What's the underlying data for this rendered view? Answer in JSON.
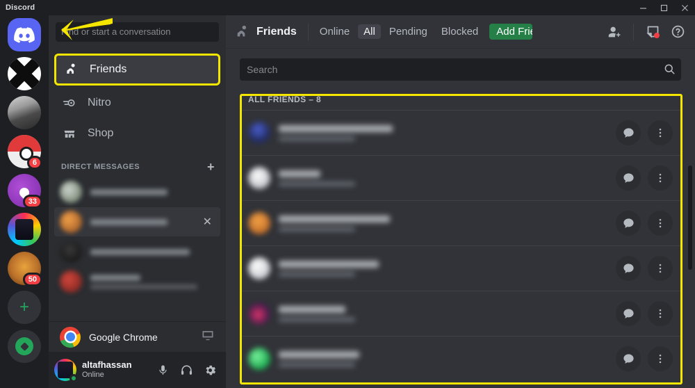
{
  "window": {
    "title": "Discord",
    "controls": {
      "minimize": "minimize-icon",
      "maximize": "maximize-icon",
      "close": "close-icon"
    }
  },
  "colors": {
    "brand_blurple": "#5865f2",
    "highlight_yellow": "#f5e600",
    "add_friend_green": "#248046",
    "online_green": "#23a55a",
    "badge_red": "#f23f43",
    "rail_bg": "#1e1f22",
    "sidebar_bg": "#2b2d31",
    "main_bg": "#313338"
  },
  "rail": {
    "home": {
      "name": "discord-home-button",
      "icon": "discord-logo-icon"
    },
    "servers": [
      {
        "name": "server-x",
        "art": "art-x",
        "badge": null
      },
      {
        "name": "server-photo",
        "art": "art-photo",
        "badge": null
      },
      {
        "name": "server-pokeball",
        "art": "art-ball",
        "badge": "6"
      },
      {
        "name": "server-purple",
        "art": "art-purple",
        "badge": "33"
      },
      {
        "name": "server-beast",
        "art": "art-beast",
        "badge": null
      },
      {
        "name": "server-lion",
        "art": "art-lion",
        "badge": "50"
      }
    ],
    "add_server": {
      "label": "+",
      "name": "add-server-button"
    },
    "explore": {
      "name": "explore-servers-button"
    }
  },
  "sidebar": {
    "search": {
      "placeholder": "Find or start a conversation",
      "value": ""
    },
    "nav": [
      {
        "label": "Friends",
        "icon": "friends-icon",
        "active": true,
        "highlighted": true
      },
      {
        "label": "Nitro",
        "icon": "nitro-icon",
        "active": false,
        "highlighted": false
      },
      {
        "label": "Shop",
        "icon": "shop-icon",
        "active": false,
        "highlighted": false
      }
    ],
    "dm_header": {
      "label": "DIRECT MESSAGES",
      "add_label": "+"
    },
    "dm_rows": [
      {
        "selected": false,
        "closable": false
      },
      {
        "selected": true,
        "closable": true
      },
      {
        "selected": false,
        "closable": false
      },
      {
        "selected": false,
        "closable": false
      }
    ],
    "activity": {
      "label": "Google Chrome",
      "icon": "chrome-icon",
      "share_icon": "screen-share-icon"
    },
    "user": {
      "name": "altafhassan",
      "status": "Online",
      "actions": [
        {
          "label": "mute-microphone",
          "icon": "microphone-icon"
        },
        {
          "label": "deafen",
          "icon": "headphones-icon"
        },
        {
          "label": "user-settings",
          "icon": "gear-icon"
        }
      ]
    }
  },
  "main": {
    "header": {
      "icon": "friends-icon",
      "title": "Friends",
      "tabs": [
        {
          "label": "Online",
          "selected": false
        },
        {
          "label": "All",
          "selected": true
        },
        {
          "label": "Pending",
          "selected": false
        },
        {
          "label": "Blocked",
          "selected": false
        }
      ],
      "add_friend": {
        "label": "Add Friend",
        "truncated_label": "Add Fri"
      },
      "right_icons": [
        {
          "name": "new-group-dm-icon"
        },
        {
          "name": "inbox-icon",
          "has_unread_dot": true
        },
        {
          "name": "help-icon"
        }
      ]
    },
    "search": {
      "placeholder": "Search",
      "value": "",
      "icon": "search-icon"
    },
    "friends_list": {
      "header": "ALL FRIENDS – 8",
      "count": 8,
      "rows": [
        {
          "name": "friend-row-1",
          "message_icon": "message-bubble-icon",
          "more_icon": "more-vertical-icon"
        },
        {
          "name": "friend-row-2",
          "message_icon": "message-bubble-icon",
          "more_icon": "more-vertical-icon"
        },
        {
          "name": "friend-row-3",
          "message_icon": "message-bubble-icon",
          "more_icon": "more-vertical-icon"
        },
        {
          "name": "friend-row-4",
          "message_icon": "message-bubble-icon",
          "more_icon": "more-vertical-icon"
        },
        {
          "name": "friend-row-5",
          "message_icon": "message-bubble-icon",
          "more_icon": "more-vertical-icon"
        },
        {
          "name": "friend-row-6",
          "message_icon": "message-bubble-icon",
          "more_icon": "more-vertical-icon"
        }
      ]
    }
  },
  "annotations": {
    "arrow": {
      "name": "yellow-arrow-pointing-to-discord-logo",
      "color": "#f5e600"
    },
    "boxes": [
      {
        "name": "highlight-box-friends-nav",
        "color": "#f5e600"
      },
      {
        "name": "highlight-box-friends-list",
        "color": "#f5e600"
      }
    ]
  }
}
